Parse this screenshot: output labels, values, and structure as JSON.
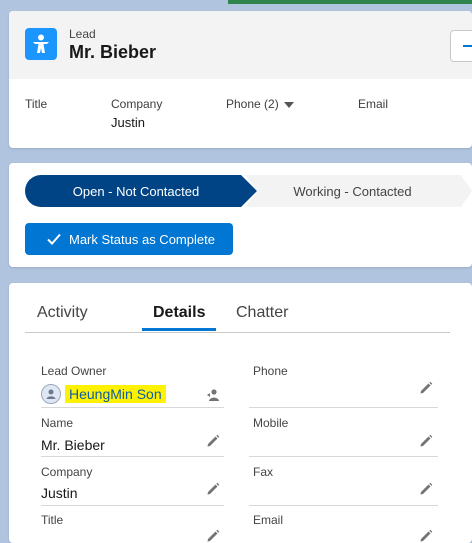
{
  "header": {
    "object_label": "Lead",
    "record_name": "Mr. Bieber",
    "fields": [
      {
        "label": "Title",
        "value": ""
      },
      {
        "label": "Company",
        "value": "Justin"
      },
      {
        "label": "Phone (2)",
        "value": ""
      },
      {
        "label": "Email",
        "value": ""
      }
    ]
  },
  "path": {
    "stages": [
      "Open - Not Contacted",
      "Working - Contacted"
    ],
    "current_stage": "Open - Not Contacted",
    "mark_button": "Mark Status as Complete"
  },
  "tabs": {
    "items": [
      "Activity",
      "Details",
      "Chatter"
    ],
    "active": "Details"
  },
  "details": {
    "lead_owner_label": "Lead Owner",
    "lead_owner_value": "HeungMin Son",
    "name_label": "Name",
    "name_value": "Mr. Bieber",
    "company_label": "Company",
    "company_value": "Justin",
    "title_label": "Title",
    "phone_label": "Phone",
    "mobile_label": "Mobile",
    "fax_label": "Fax",
    "email_label": "Email"
  },
  "colors": {
    "brand_blue": "#0176d3",
    "path_active": "#014486",
    "highlight": "#fff200",
    "lead_icon": "#1b96ff"
  }
}
